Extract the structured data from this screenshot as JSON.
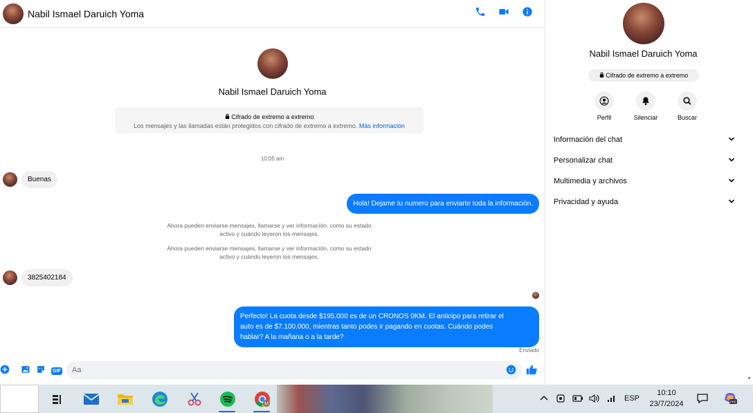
{
  "header": {
    "contact_name": "Nabil Ismael Daruich Yoma"
  },
  "intro": {
    "contact_name": "Nabil Ismael Daruich Yoma",
    "e2e_title": "Cifrado de extremo a extremo",
    "e2e_text": "Los mensajes y las llamadas están protegidos con cifrado de extremo a extremo.",
    "e2e_link": "Más información"
  },
  "messages": {
    "time": "10:05 am",
    "m1": "Buenas",
    "m2": "Hola! Dejame tu numero  para enviarte toda la información.",
    "sys1_line1": "Ahora pueden enviarse mensajes, llamarse y ver información, como su estado",
    "sys1_line2": "activo y cuándo leyeron los mensajes.",
    "sys2_line1": "Ahora pueden enviarse mensajes, llamarse y ver información, como su estado",
    "sys2_line2": "activo y cuándo leyeron los mensajes.",
    "m3": "3825402184",
    "m4_line1": "Perfecto! La cuota desde $195.000 es de un CRONOS 0KM. El anticipo para retirar el",
    "m4_line2": "auto es de $7.100.000, mientras tanto podes ir pagando en cuotas. Cuándo podes",
    "m4_line3": "hablar? A la mañana o a la tarde?",
    "sent_status": "Enviado"
  },
  "composer": {
    "placeholder": "Aa",
    "gif_label": "GIF"
  },
  "panel": {
    "contact_name": "Nabil Ismael Daruich Yoma",
    "e2e_chip": "Cifrado de extremo a extremo",
    "actions": [
      {
        "label": "Perfil",
        "icon": "profile-icon"
      },
      {
        "label": "Silenciar",
        "icon": "bell-icon"
      },
      {
        "label": "Buscar",
        "icon": "search-icon"
      }
    ],
    "menu": [
      {
        "label": "Información del chat"
      },
      {
        "label": "Personalizar chat"
      },
      {
        "label": "Multimedia y archivos"
      },
      {
        "label": "Privacidad y ayuda"
      }
    ]
  },
  "taskbar": {
    "language": "ESP",
    "time": "10:10",
    "date": "23/7/2024",
    "copilot_badge": "PRE"
  },
  "colors": {
    "accent": "#0a7cff",
    "link": "#0064d1"
  }
}
